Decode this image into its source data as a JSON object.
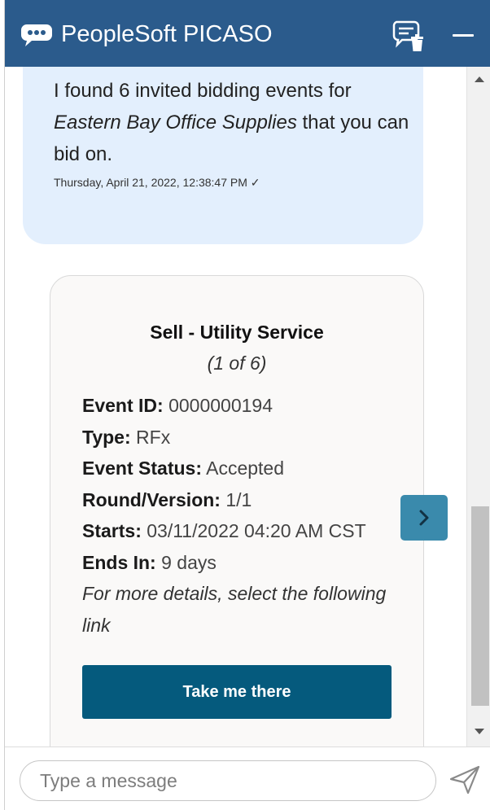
{
  "header": {
    "title": "PeopleSoft PICASO",
    "icons": {
      "brand": "chat-bubble-icon",
      "clear": "clear-chat-icon",
      "minimize": "minimize-icon"
    },
    "colors": {
      "background": "#2b5b8c",
      "text": "#ffffff"
    }
  },
  "bot_message": {
    "text_before": "I found 6 invited bidding events for",
    "supplier": "Eastern Bay Office Supplies",
    "text_after": "that you can bid on.",
    "timestamp": "Thursday, April 21, 2022, 12:38:47 PM ✓",
    "bubble_color": "#e3effd"
  },
  "card": {
    "title": "Sell - Utility Service",
    "position_text": "(1 of 6)",
    "fields": [
      {
        "label": "Event ID:",
        "value": "0000000194"
      },
      {
        "label": "Type:",
        "value": "RFx"
      },
      {
        "label": "Event Status:",
        "value": "Accepted"
      },
      {
        "label": "Round/Version:",
        "value": "1/1"
      },
      {
        "label": "Starts:",
        "value": "03/11/2022 04:20 AM CST"
      },
      {
        "label": "Ends In:",
        "value": "9 days"
      }
    ],
    "more_details": "For more details, select the following link",
    "action_label": "Take me there",
    "action_color": "#055a7d"
  },
  "carousel": {
    "next_icon": "chevron-right-icon",
    "color": "#3a8aac"
  },
  "scrollbar": {
    "up_icon": "scroll-up-arrow-icon",
    "down_icon": "scroll-down-arrow-icon"
  },
  "composer": {
    "placeholder": "Type a message",
    "value": "",
    "send_icon": "send-icon"
  }
}
